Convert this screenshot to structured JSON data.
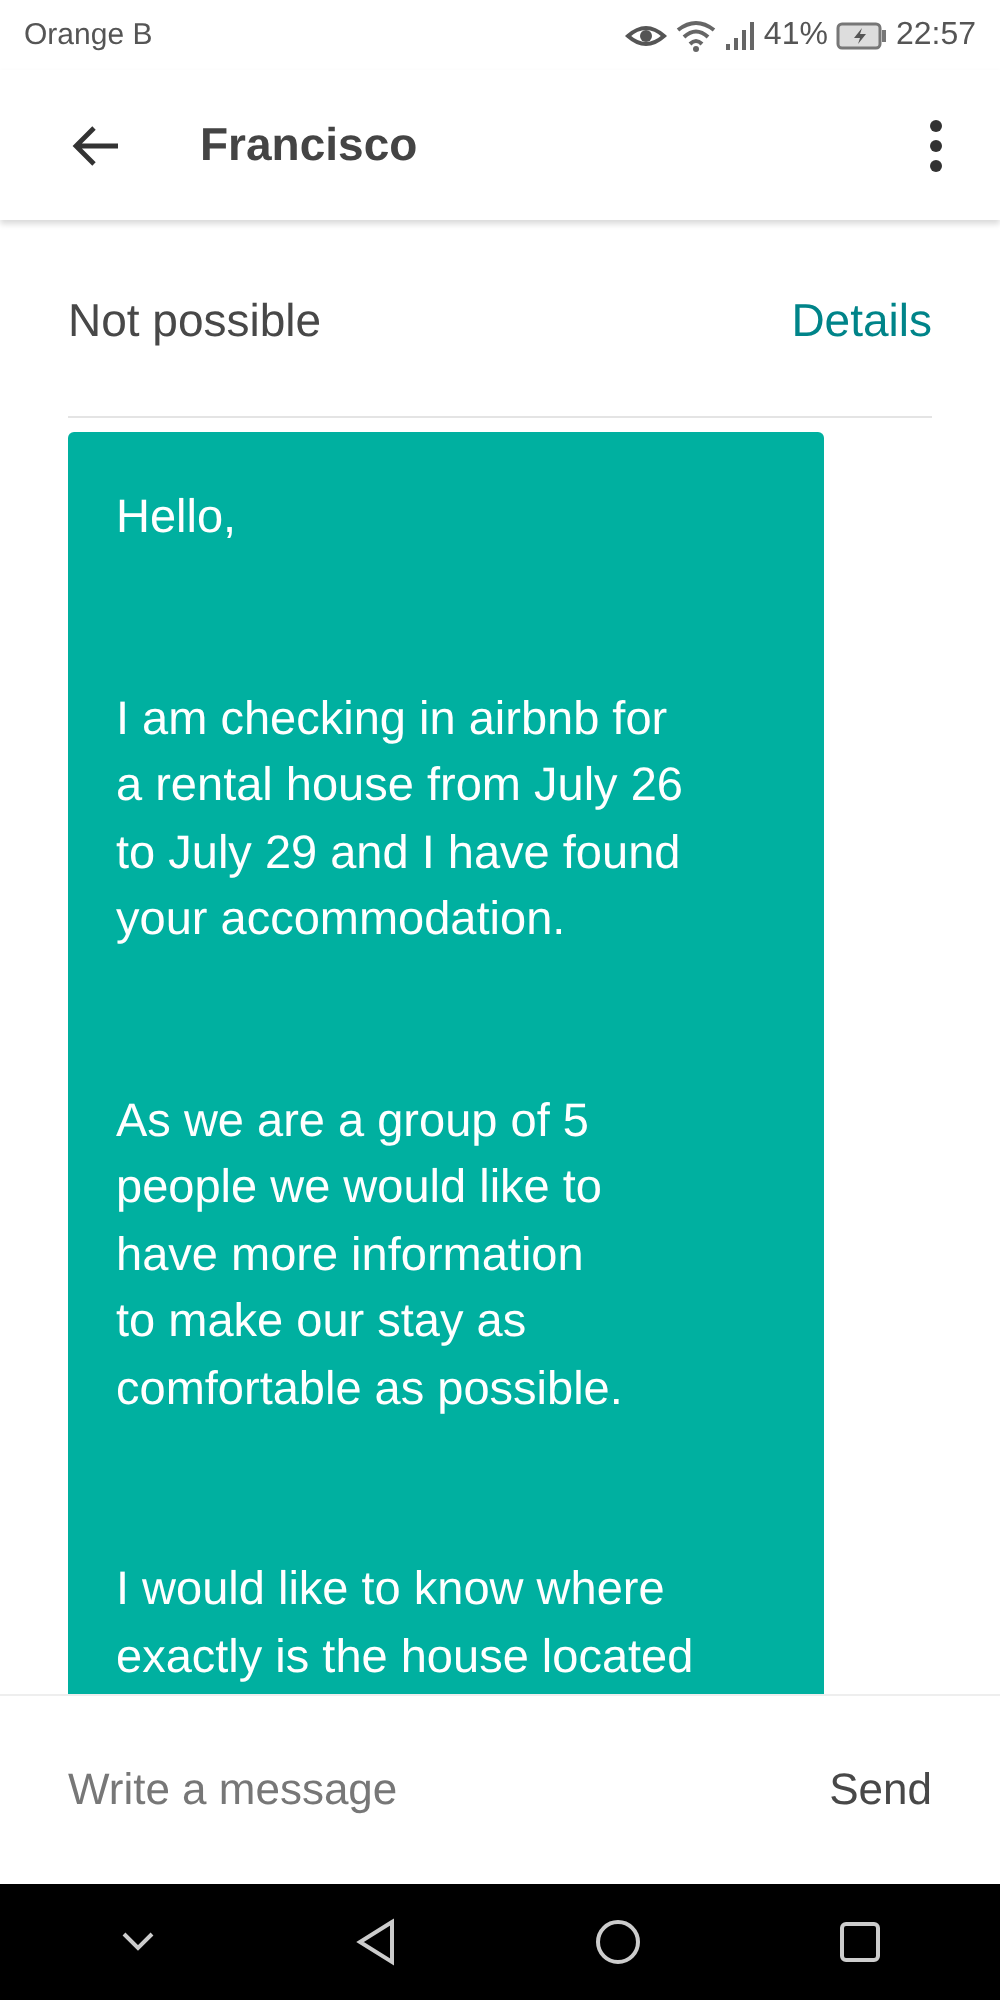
{
  "status_bar": {
    "carrier": "Orange B",
    "battery": "41%",
    "time": "22:57"
  },
  "header": {
    "title": "Francisco"
  },
  "request": {
    "status": "Not possible",
    "link": "Details"
  },
  "messages": [
    {
      "paragraphs": [
        [
          "Hello,"
        ],
        [
          "I am checking in airbnb for",
          "a rental house from July 26",
          "to July 29 and I have found",
          "your accommodation."
        ],
        [
          "As we are a group of 5",
          "people we would like to",
          "have more information",
          "to make our stay as",
          "comfortable as possible."
        ],
        [
          "I would like to know where",
          "exactly is the house located"
        ]
      ]
    }
  ],
  "composer": {
    "placeholder": "Write a message",
    "send": "Send"
  }
}
